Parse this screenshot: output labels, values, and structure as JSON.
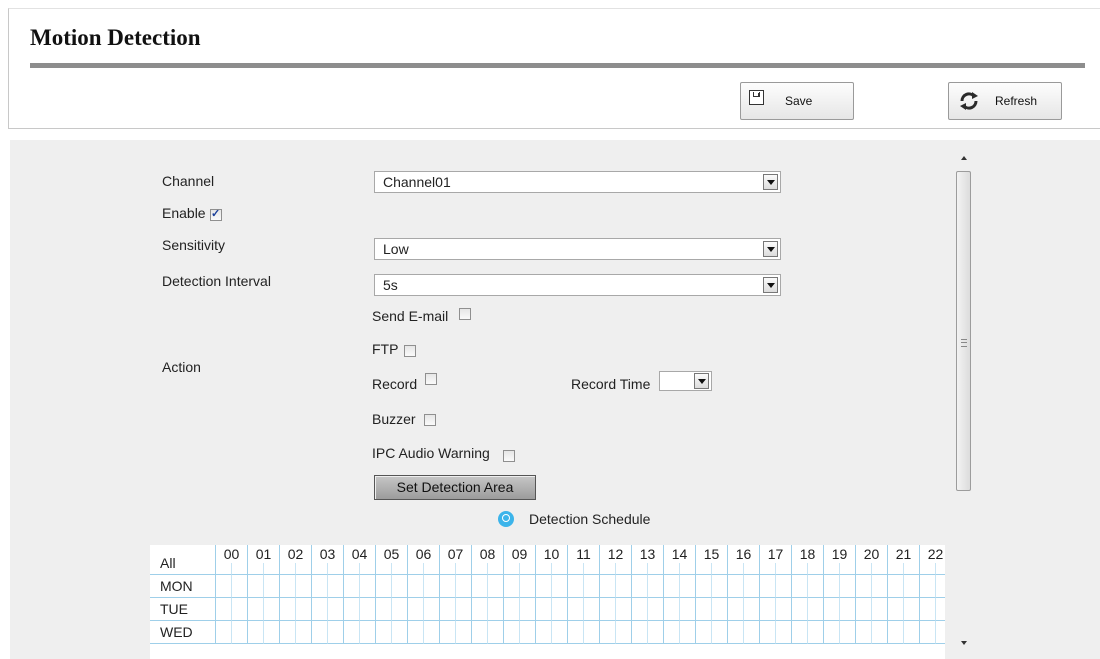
{
  "page": {
    "title": "Motion Detection"
  },
  "toolbar": {
    "save_label": "Save",
    "refresh_label": "Refresh"
  },
  "form": {
    "channel": {
      "label": "Channel",
      "value": "Channel01"
    },
    "enable": {
      "label": "Enable",
      "checked": true
    },
    "sensitivity": {
      "label": "Sensitivity",
      "value": "Low"
    },
    "detection_interval": {
      "label": "Detection Interval",
      "value": "5s"
    },
    "action": {
      "label": "Action",
      "send_email": {
        "label": "Send E-mail",
        "checked": false
      },
      "ftp": {
        "label": "FTP",
        "checked": false
      },
      "record": {
        "label": "Record",
        "checked": false
      },
      "record_time": {
        "label": "Record Time",
        "value": ""
      },
      "buzzer": {
        "label": "Buzzer",
        "checked": false
      },
      "ipc_audio_warning": {
        "label": "IPC Audio Warning",
        "checked": false
      }
    },
    "set_area_label": "Set Detection Area"
  },
  "schedule": {
    "title": "Detection Schedule",
    "all_label": "All",
    "hours": [
      "00",
      "01",
      "02",
      "03",
      "04",
      "05",
      "06",
      "07",
      "08",
      "09",
      "10",
      "11",
      "12",
      "13",
      "14",
      "15",
      "16",
      "17",
      "18",
      "19",
      "20",
      "21",
      "22"
    ],
    "days": [
      "MON",
      "TUE",
      "WED"
    ]
  },
  "colors": {
    "grid_line": "#9fcfe9",
    "panel_bg": "#efefef",
    "accent_icon": "#3cb4ea"
  }
}
